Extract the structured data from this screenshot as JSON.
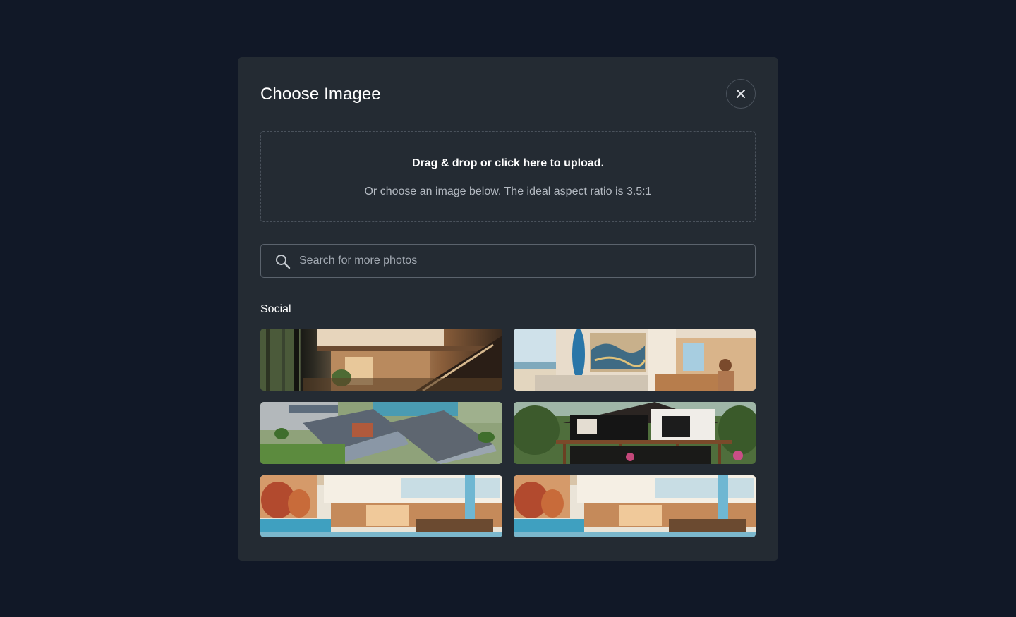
{
  "modal": {
    "title": "Choose Imagee",
    "close_icon": "close-icon"
  },
  "dropzone": {
    "primary_text": "Drag & drop or click here to upload.",
    "secondary_text": "Or choose an image below. The ideal aspect ratio is 3.5:1"
  },
  "search": {
    "placeholder": "Search for more photos",
    "value": "",
    "icon": "search-icon"
  },
  "gallery": {
    "section_label": "Social",
    "images": [
      {
        "name": "modern-interior-staircase-photo"
      },
      {
        "name": "beach-house-living-room-photo"
      },
      {
        "name": "aerial-apartment-complex-photo"
      },
      {
        "name": "modern-house-deck-photo"
      },
      {
        "name": "villa-pool-terrace-photo"
      },
      {
        "name": "villa-pool-terrace-photo-duplicate"
      }
    ]
  },
  "colors": {
    "background": "#111827",
    "modal": "#242b33",
    "border": "#4a525c"
  }
}
